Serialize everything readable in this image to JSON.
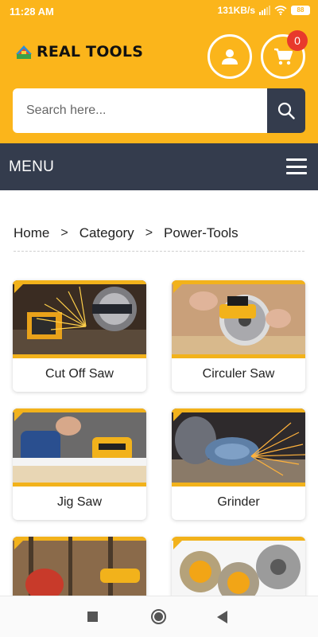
{
  "status_bar": {
    "time": "11:28 AM",
    "network_speed": "131KB/s",
    "battery": "88",
    "icons": [
      "signal-icon",
      "wifi-icon",
      "battery-icon"
    ]
  },
  "header": {
    "brand": "REAL TOOLS",
    "cart_count": "0",
    "icons": [
      "logo-icon",
      "account-icon",
      "cart-icon"
    ],
    "colors": {
      "primary": "#fbb51b",
      "dark": "#343c4d",
      "badge": "#e8392c"
    }
  },
  "search": {
    "placeholder": "Search here...",
    "value": "",
    "button_icon": "search-icon"
  },
  "menu": {
    "label": "MENU",
    "icon": "hamburger-icon"
  },
  "breadcrumb": {
    "items": [
      "Home",
      "Category",
      "Power-Tools"
    ],
    "separator": ">"
  },
  "categories": [
    {
      "label": "Cut Off Saw"
    },
    {
      "label": "Circuler Saw"
    },
    {
      "label": "Jig Saw"
    },
    {
      "label": "Grinder"
    },
    {
      "label": ""
    },
    {
      "label": ""
    }
  ],
  "nav_bar": {
    "icons": [
      "recents-icon",
      "home-icon",
      "back-icon"
    ]
  }
}
